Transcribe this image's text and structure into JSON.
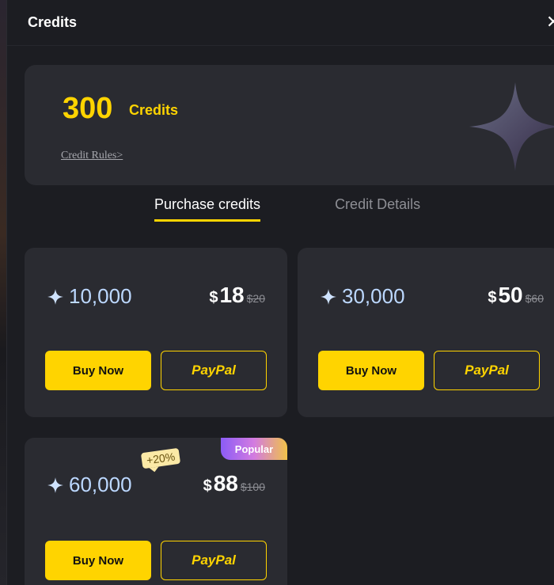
{
  "header": {
    "title": "Credits",
    "close_glyph": "✕"
  },
  "balance": {
    "amount": "300",
    "unit": "Credits",
    "rules_link": "Credit Rules>"
  },
  "tabs": [
    {
      "label": "Purchase credits",
      "active": true
    },
    {
      "label": "Credit Details",
      "active": false
    }
  ],
  "packages": [
    {
      "credits": "10,000",
      "currency": "$",
      "price": "18",
      "original": "$20",
      "buy_label": "Buy Now",
      "paypal_label": "PayPal"
    },
    {
      "credits": "30,000",
      "currency": "$",
      "price": "50",
      "original": "$60",
      "buy_label": "Buy Now",
      "paypal_label": "PayPal"
    },
    {
      "credits": "60,000",
      "currency": "$",
      "price": "88",
      "original": "$100",
      "buy_label": "Buy Now",
      "paypal_label": "PayPal",
      "bonus_badge": "+20%",
      "popular_badge": "Popular"
    }
  ],
  "colors": {
    "accent": "#ffd400",
    "card": "#2a2b31",
    "background": "#1c1d22",
    "credit_text": "#bcd8ff"
  },
  "icons": [
    "close-icon",
    "sparkle-star-icon"
  ]
}
